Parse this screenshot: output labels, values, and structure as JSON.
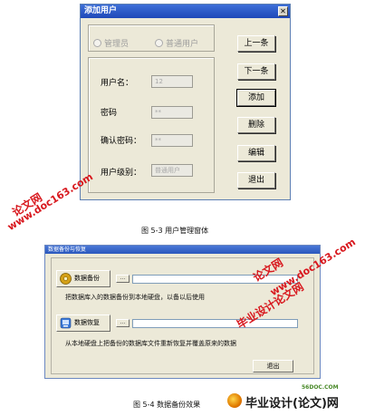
{
  "win1": {
    "title": "添加用户",
    "close": "✕",
    "radio_admin": "管理员",
    "radio_normal": "普通用户",
    "label_username": "用户名：",
    "label_password": "密码",
    "label_confirm": "确认密码：",
    "label_level": "用户级别：",
    "val_username": "12",
    "val_password": "**",
    "val_confirm": "**",
    "val_level": "普通用户",
    "btn_prev": "上一条",
    "btn_next": "下一条",
    "btn_add": "添加",
    "btn_delete": "删除",
    "btn_edit": "编辑",
    "btn_exit": "退出"
  },
  "caption1": "图 5-3 用户管理窗体",
  "win2": {
    "title": "数据备份与恢复",
    "backup_label": "数据备份",
    "backup_browse": "...",
    "backup_desc": "把数据库入的数据备份到本地硬盘，以备以后使用",
    "restore_label": "数据恢复",
    "restore_browse": "...",
    "restore_desc": "从本地硬盘上把备份的数据库文件重新恢复并覆盖原来的数据",
    "exit": "退出"
  },
  "caption2": "图 5-4 数据备份效果",
  "watermarks": {
    "wm1a": "论文网",
    "wm1b": "www.doc163.com",
    "wm2a": "论文网",
    "wm2b": "www.doc163.com",
    "wm3": "毕业设计论文网",
    "logo_small": "56DOC.COM",
    "logo_big": "毕业设计(论文)网"
  },
  "colors": {
    "watermark_red": "#d8181e",
    "xp_face": "#ece9d8",
    "title_blue": "#2a57bd"
  }
}
